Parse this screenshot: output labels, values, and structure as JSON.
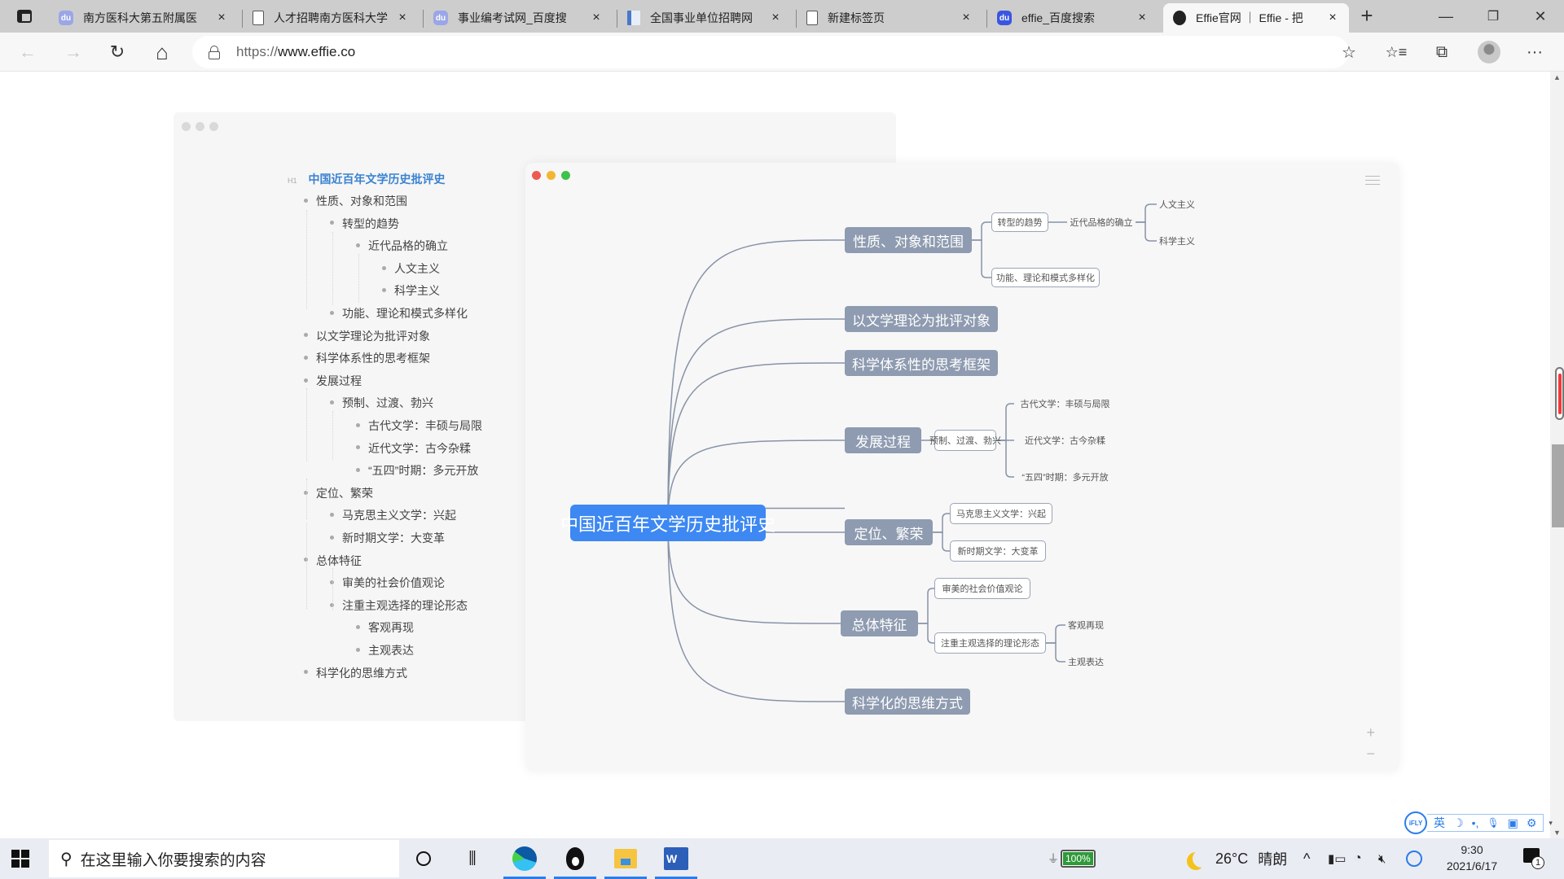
{
  "browser": {
    "tabs": [
      {
        "title": "南方医科大第五附属医",
        "favicon": "baidu-paw-icon",
        "active": false
      },
      {
        "title": "人才招聘南方医科大学",
        "favicon": "document-icon",
        "active": false
      },
      {
        "title": "事业编考试网_百度搜",
        "favicon": "baidu-paw-icon",
        "active": false
      },
      {
        "title": "全国事业单位招聘网",
        "favicon": "site-icon",
        "active": false
      },
      {
        "title": "新建标签页",
        "favicon": "document-icon",
        "active": false
      },
      {
        "title": "effie_百度搜索",
        "favicon": "baidu-paw-icon",
        "active": false
      },
      {
        "title": "Effie官网 ｜ Effie - 把",
        "favicon": "effie-logo-icon",
        "active": true
      }
    ],
    "close_glyph": "×",
    "new_tab_glyph": "+",
    "window_controls": {
      "minimize": "—",
      "maximize": "❐",
      "close": "✕"
    },
    "nav": {
      "back": "←",
      "forward": "→",
      "refresh": "↻",
      "home": "⌂"
    },
    "address": {
      "protocol": "https://",
      "host": "www.effie.co"
    },
    "toolbar_icons": {
      "add_favorite": "☆",
      "favorites": "☆≡",
      "collections": "⧉",
      "more": "···"
    }
  },
  "outline": {
    "heading_tag": "H1",
    "title": "中国近百年文学历史批评史",
    "items": [
      {
        "level": 1,
        "text": "性质、对象和范围"
      },
      {
        "level": 2,
        "text": "转型的趋势"
      },
      {
        "level": 3,
        "text": "近代品格的确立"
      },
      {
        "level": 4,
        "text": "人文主义"
      },
      {
        "level": 4,
        "text": "科学主义"
      },
      {
        "level": 2,
        "text": "功能、理论和模式多样化"
      },
      {
        "level": 1,
        "text": "以文学理论为批评对象"
      },
      {
        "level": 1,
        "text": "科学体系性的思考框架"
      },
      {
        "level": 1,
        "text": "发展过程"
      },
      {
        "level": 2,
        "text": "预制、过渡、勃兴"
      },
      {
        "level": 3,
        "text": "古代文学：丰硕与局限"
      },
      {
        "level": 3,
        "text": "近代文学：古今杂糅"
      },
      {
        "level": 3,
        "text": "“五四”时期：多元开放"
      },
      {
        "level": 1,
        "text": "定位、繁荣"
      },
      {
        "level": 2,
        "text": "马克思主义文学：兴起"
      },
      {
        "level": 2,
        "text": "新时期文学：大变革"
      },
      {
        "level": 1,
        "text": "总体特征"
      },
      {
        "level": 2,
        "text": "审美的社会价值观论"
      },
      {
        "level": 2,
        "text": "注重主观选择的理论形态"
      },
      {
        "level": 3,
        "text": "客观再现"
      },
      {
        "level": 3,
        "text": "主观表达"
      },
      {
        "level": 1,
        "text": "科学化的思维方式"
      }
    ]
  },
  "mindmap": {
    "window_dot_colors": [
      "#ee5a52",
      "#f2b630",
      "#3ec24a"
    ],
    "root": "中国近百年文学历史批评史",
    "branches": [
      {
        "label": "性质、对象和范围",
        "children": [
          {
            "label": "转型的趋势",
            "children": [
              {
                "label": "近代品格的确立",
                "children": [
                  {
                    "label": "人文主义"
                  },
                  {
                    "label": "科学主义"
                  }
                ]
              }
            ]
          },
          {
            "label": "功能、理论和模式多样化"
          }
        ]
      },
      {
        "label": "以文学理论为批评对象"
      },
      {
        "label": "科学体系性的思考框架"
      },
      {
        "label": "发展过程",
        "children": [
          {
            "label": "预制、过渡、勃兴",
            "children": [
              {
                "label": "古代文学：丰硕与局限"
              },
              {
                "label": "近代文学：古今杂糅"
              },
              {
                "label": "“五四”时期：多元开放"
              }
            ]
          }
        ]
      },
      {
        "label": "定位、繁荣",
        "children": [
          {
            "label": "马克思主义文学：兴起"
          },
          {
            "label": "新时期文学：大变革"
          }
        ]
      },
      {
        "label": "总体特征",
        "children": [
          {
            "label": "审美的社会价值观论"
          },
          {
            "label": "注重主观选择的理论形态",
            "children": [
              {
                "label": "客观再现"
              },
              {
                "label": "主观表达"
              }
            ]
          }
        ]
      },
      {
        "label": "科学化的思维方式"
      }
    ],
    "zoom_in": "+",
    "zoom_out": "−",
    "colors": {
      "root": "#3d88f2",
      "branch": "#8e9bb0",
      "edge": "#8793a6"
    }
  },
  "ime": {
    "logo": "iFLY",
    "mode": "英",
    "icons": [
      "moon-icon",
      "punctuation-icon",
      "microphone-icon",
      "voice-input-icon",
      "settings-icon"
    ],
    "glyphs": [
      "☽",
      "•,",
      "🎙",
      "▣",
      "⚙"
    ],
    "dropdown": "▾"
  },
  "taskbar": {
    "search_placeholder": "在这里输入你要搜索的内容",
    "battery": "100%",
    "weather_temp": "26°C",
    "weather_desc": "晴朗",
    "tray_up": "^",
    "time": "9:30",
    "date": "2021/6/17",
    "notifications": "1"
  }
}
